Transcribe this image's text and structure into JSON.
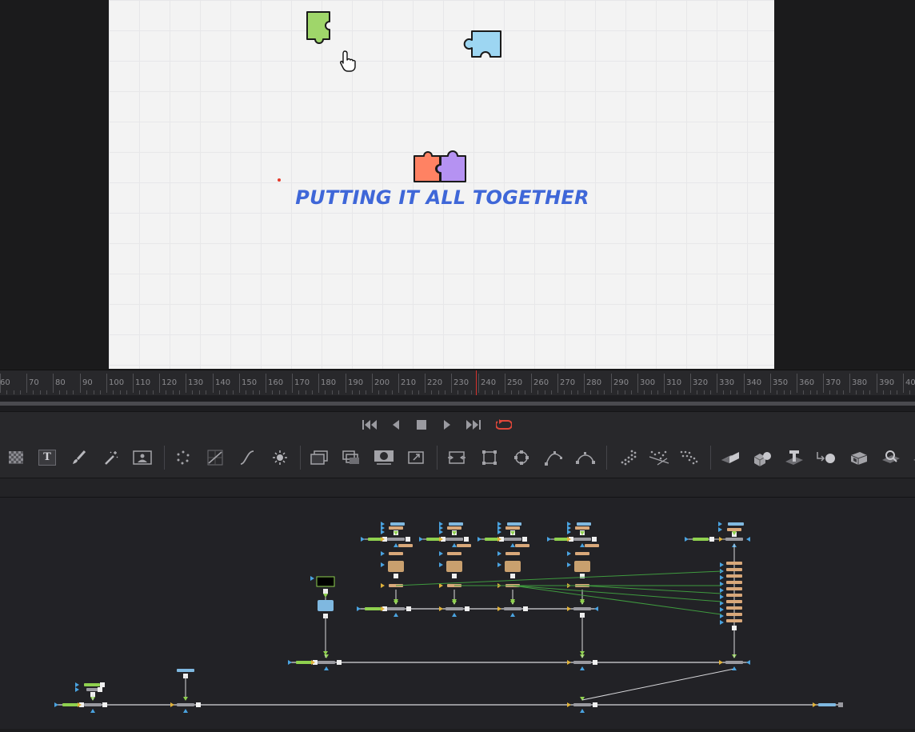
{
  "viewer": {
    "title_text": "PUTTING IT ALL TOGETHER",
    "colors": {
      "green_piece": "#9fd66a",
      "blue_piece": "#9dd6f2",
      "orange_piece": "#ff8263",
      "purple_piece": "#b592f2",
      "title": "#3f67d8"
    }
  },
  "timeline": {
    "ruler_labels": [
      "60",
      "70",
      "80",
      "90",
      "100",
      "110",
      "120",
      "130",
      "140",
      "150",
      "160",
      "170",
      "180",
      "190",
      "200",
      "210",
      "220",
      "230",
      "240",
      "250",
      "260",
      "270",
      "280",
      "290",
      "300",
      "310",
      "320",
      "330",
      "340",
      "350",
      "360",
      "370",
      "380",
      "390",
      "400"
    ],
    "current_frame": "240"
  },
  "transport": {
    "buttons": [
      "skip-to-start",
      "play-reverse",
      "stop",
      "play-forward",
      "skip-to-end",
      "loop"
    ]
  },
  "toolbar": {
    "tools": [
      "background",
      "text",
      "paint",
      "magic-wand",
      "image-plane",
      "particles",
      "color-corrector",
      "curves",
      "brightness",
      "merge",
      "channel-booleans",
      "matte-control",
      "transform",
      "crop",
      "rectangle-mask",
      "ellipse-mask",
      "polygon-mask",
      "bspline-mask",
      "pEmitter",
      "pRender",
      "pDirectional",
      "shape3d",
      "merge3d",
      "text3d",
      "renderer3d",
      "camera3d",
      "light3d"
    ],
    "text_tool_glyph": "T"
  }
}
